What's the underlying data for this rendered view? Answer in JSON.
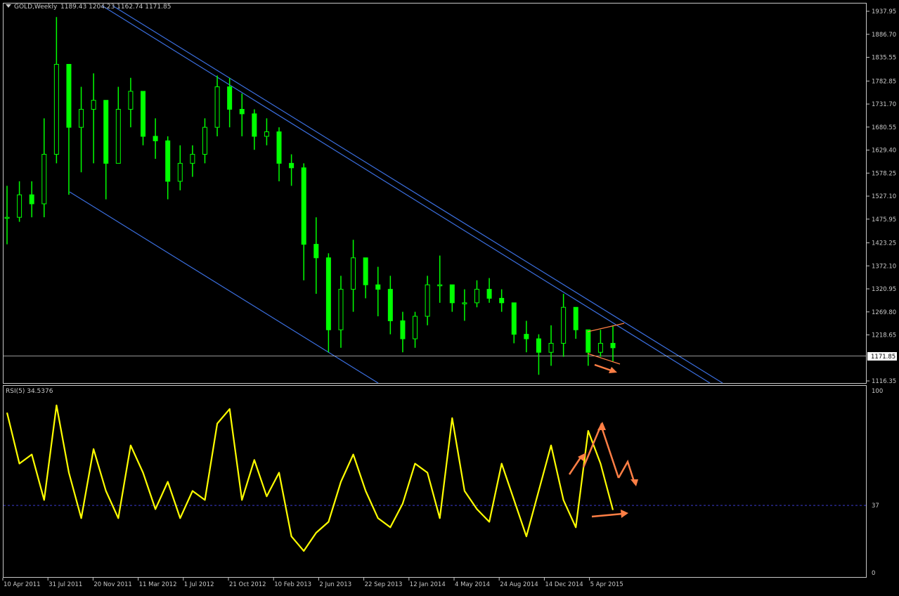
{
  "symbol_header": "GOLD,Weekly",
  "ohlc_header": "1189.43 1204.23 1162.74 1171.85",
  "rsi_header": "RSI(5) 34.5376",
  "price_axis": {
    "ticks": [
      "1937.95",
      "1886.70",
      "1835.55",
      "1782.85",
      "1731.70",
      "1680.55",
      "1629.40",
      "1578.25",
      "1527.10",
      "1475.95",
      "1423.25",
      "1372.10",
      "1320.95",
      "1269.80",
      "1218.65",
      "1116.35"
    ],
    "current_price_label": "1171.85"
  },
  "rsi_axis": {
    "ticks": [
      "100",
      "37",
      "0"
    ]
  },
  "time_axis": [
    "10 Apr 2011",
    "31 Jul 2011",
    "20 Nov 2011",
    "11 Mar 2012",
    "1 Jul 2012",
    "21 Oct 2012",
    "10 Feb 2013",
    "2 Jun 2013",
    "22 Sep 2013",
    "12 Jan 2014",
    "4 May 2014",
    "24 Aug 2014",
    "14 Dec 2014",
    "5 Apr 2015"
  ],
  "colors": {
    "background": "#000000",
    "candles": "#00ff00",
    "rsi_line": "#ffff00",
    "trend_channel": "#3b6fe0",
    "annotation": "#ff7f45",
    "axis_text": "#c8c8c8",
    "frame": "#c8c8c8",
    "rsi_level_line": "#3a3ad0"
  },
  "chart_data": [
    {
      "type": "candlestick",
      "title": "GOLD,Weekly",
      "ylim": [
        1100,
        1950
      ],
      "current_price": 1171.85,
      "x": [
        "2011-04",
        "2011-05",
        "2011-06",
        "2011-07",
        "2011-08",
        "2011-09",
        "2011-10",
        "2011-11",
        "2011-12",
        "2012-01",
        "2012-02",
        "2012-03",
        "2012-04",
        "2012-05",
        "2012-06",
        "2012-07",
        "2012-08",
        "2012-09",
        "2012-10",
        "2012-11",
        "2012-12",
        "2013-01",
        "2013-02",
        "2013-03",
        "2013-04",
        "2013-05",
        "2013-06",
        "2013-07",
        "2013-08",
        "2013-09",
        "2013-10",
        "2013-11",
        "2013-12",
        "2014-01",
        "2014-02",
        "2014-03",
        "2014-04",
        "2014-05",
        "2014-06",
        "2014-07",
        "2014-08",
        "2014-09",
        "2014-10",
        "2014-11",
        "2014-12",
        "2015-01",
        "2015-02",
        "2015-03",
        "2015-04",
        "2015-05"
      ],
      "close": [
        1480,
        1530,
        1510,
        1620,
        1820,
        1680,
        1720,
        1740,
        1600,
        1720,
        1760,
        1660,
        1650,
        1560,
        1600,
        1620,
        1680,
        1770,
        1720,
        1710,
        1660,
        1670,
        1600,
        1590,
        1420,
        1390,
        1230,
        1320,
        1390,
        1330,
        1320,
        1250,
        1210,
        1260,
        1330,
        1330,
        1290,
        1290,
        1320,
        1300,
        1290,
        1220,
        1210,
        1180,
        1200,
        1280,
        1230,
        1180,
        1200,
        1190
      ],
      "high": [
        1550,
        1560,
        1560,
        1700,
        1925,
        1800,
        1770,
        1800,
        1730,
        1770,
        1790,
        1720,
        1700,
        1660,
        1640,
        1640,
        1700,
        1795,
        1790,
        1755,
        1720,
        1700,
        1680,
        1620,
        1600,
        1480,
        1400,
        1350,
        1430,
        1380,
        1370,
        1350,
        1270,
        1270,
        1350,
        1395,
        1330,
        1320,
        1340,
        1345,
        1320,
        1260,
        1250,
        1220,
        1240,
        1310,
        1280,
        1220,
        1230,
        1240
      ],
      "low": [
        1420,
        1470,
        1480,
        1480,
        1600,
        1530,
        1580,
        1600,
        1520,
        1620,
        1680,
        1640,
        1610,
        1520,
        1540,
        1570,
        1600,
        1660,
        1680,
        1660,
        1630,
        1640,
        1560,
        1550,
        1340,
        1310,
        1180,
        1190,
        1270,
        1300,
        1260,
        1220,
        1180,
        1190,
        1240,
        1290,
        1270,
        1250,
        1280,
        1290,
        1270,
        1200,
        1180,
        1130,
        1150,
        1170,
        1210,
        1150,
        1170,
        1160
      ]
    },
    {
      "type": "line",
      "title": "RSI(5) 34.5376",
      "ylim": [
        0,
        100
      ],
      "level": 37,
      "x": [
        "2011-04",
        "2011-05",
        "2011-06",
        "2011-07",
        "2011-08",
        "2011-09",
        "2011-10",
        "2011-11",
        "2011-12",
        "2012-01",
        "2012-02",
        "2012-03",
        "2012-04",
        "2012-05",
        "2012-06",
        "2012-07",
        "2012-08",
        "2012-09",
        "2012-10",
        "2012-11",
        "2012-12",
        "2013-01",
        "2013-02",
        "2013-03",
        "2013-04",
        "2013-05",
        "2013-06",
        "2013-07",
        "2013-08",
        "2013-09",
        "2013-10",
        "2013-11",
        "2013-12",
        "2014-01",
        "2014-02",
        "2014-03",
        "2014-04",
        "2014-05",
        "2014-06",
        "2014-07",
        "2014-08",
        "2014-09",
        "2014-10",
        "2014-11",
        "2014-12",
        "2015-01",
        "2015-02",
        "2015-03",
        "2015-04",
        "2015-05"
      ],
      "series": [
        {
          "values": [
            88,
            60,
            65,
            40,
            92,
            55,
            30,
            68,
            45,
            30,
            70,
            55,
            35,
            50,
            30,
            45,
            40,
            82,
            90,
            40,
            62,
            42,
            55,
            20,
            12,
            22,
            28,
            50,
            65,
            45,
            30,
            25,
            38,
            60,
            55,
            30,
            85,
            45,
            35,
            28,
            60,
            40,
            20,
            45,
            70,
            40,
            25,
            78,
            60,
            34.5
          ]
        }
      ]
    }
  ]
}
